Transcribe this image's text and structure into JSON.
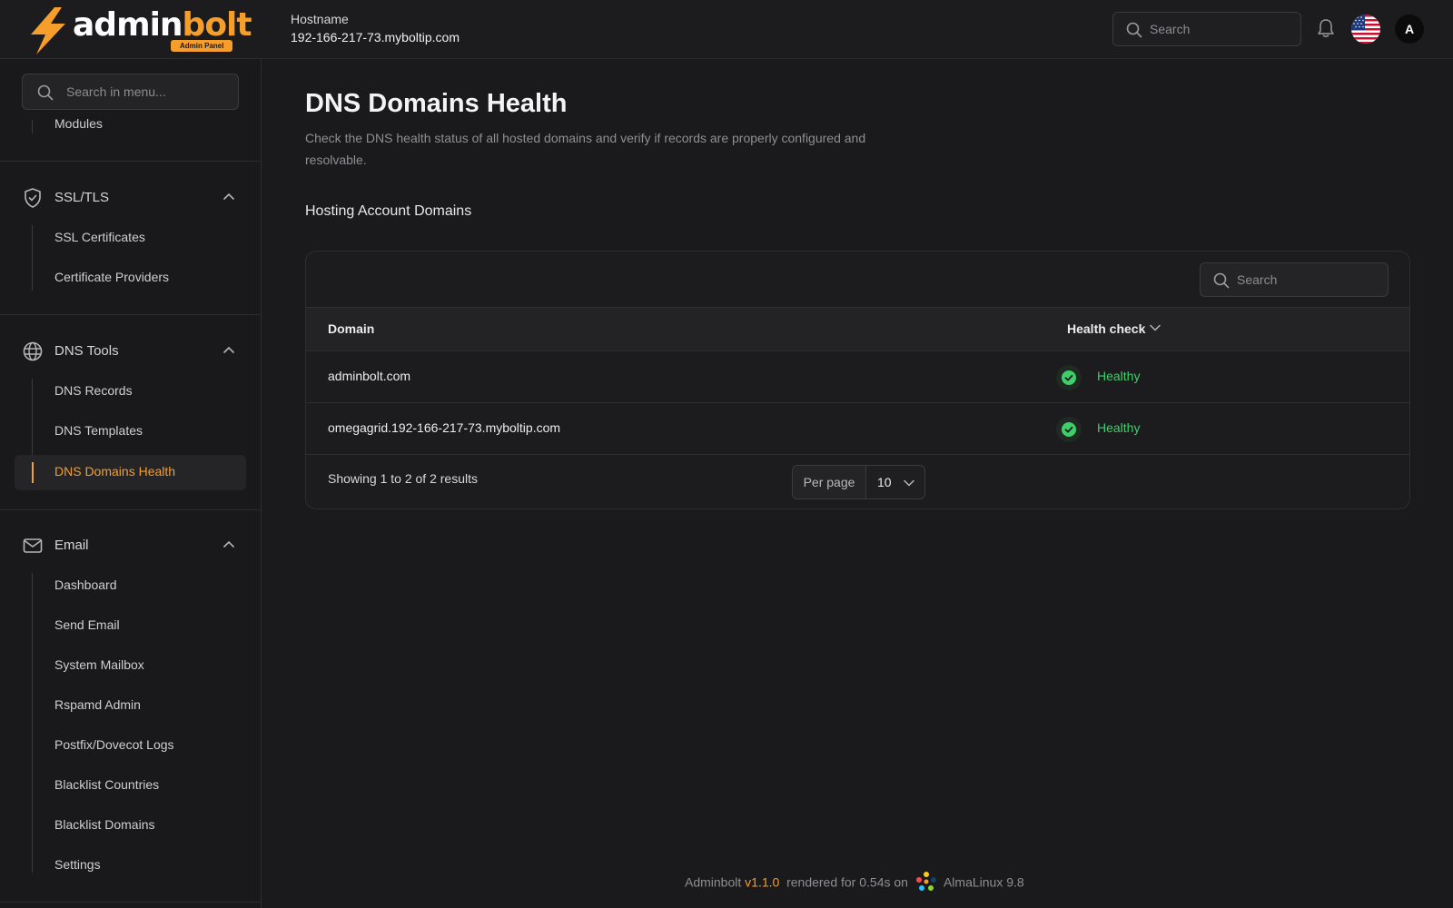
{
  "brand": {
    "word_part1": "admin",
    "word_part2": "bolt",
    "badge": "Admin Panel",
    "accent_color": "#f59e2b"
  },
  "header": {
    "host_label": "Hostname",
    "host_value": "192-166-217-73.myboltip.com",
    "search_placeholder": "Search",
    "avatar_initial": "A",
    "flag": "us-flag-icon"
  },
  "sidebar": {
    "search_placeholder": "Search in menu...",
    "partial_item": "Modules",
    "groups": [
      {
        "label": "SSL/TLS",
        "icon": "shield-check-icon",
        "items": [
          "SSL Certificates",
          "Certificate Providers"
        ]
      },
      {
        "label": "DNS Tools",
        "icon": "globe-icon",
        "items": [
          "DNS Records",
          "DNS Templates",
          "DNS Domains Health"
        ]
      },
      {
        "label": "Email",
        "icon": "mail-icon",
        "items": [
          "Dashboard",
          "Send Email",
          "System Mailbox",
          "Rspamd Admin",
          "Postfix/Dovecot Logs",
          "Blacklist Countries",
          "Blacklist Domains",
          "Settings"
        ]
      }
    ],
    "active_item": "DNS Domains Health"
  },
  "main": {
    "title": "DNS Domains Health",
    "description": "Check the DNS health status of all hosted domains and verify if records are properly configured and resolvable.",
    "section_title": "Hosting Account Domains",
    "table": {
      "search_placeholder": "Search",
      "columns": [
        "Domain",
        "Health check"
      ],
      "rows": [
        {
          "domain": "adminbolt.com",
          "status": "Healthy"
        },
        {
          "domain": "omegagrid.192-166-217-73.myboltip.com",
          "status": "Healthy"
        }
      ],
      "summary": "Showing 1 to 2 of 2 results",
      "per_page_label": "Per page",
      "per_page_value": "10",
      "healthy_color": "#3fcf6a"
    }
  },
  "footer": {
    "app_name": "Adminbolt",
    "version": "v1.1.0",
    "rendered_text": "rendered for 0.54s on",
    "os": "AlmaLinux 9.8"
  }
}
